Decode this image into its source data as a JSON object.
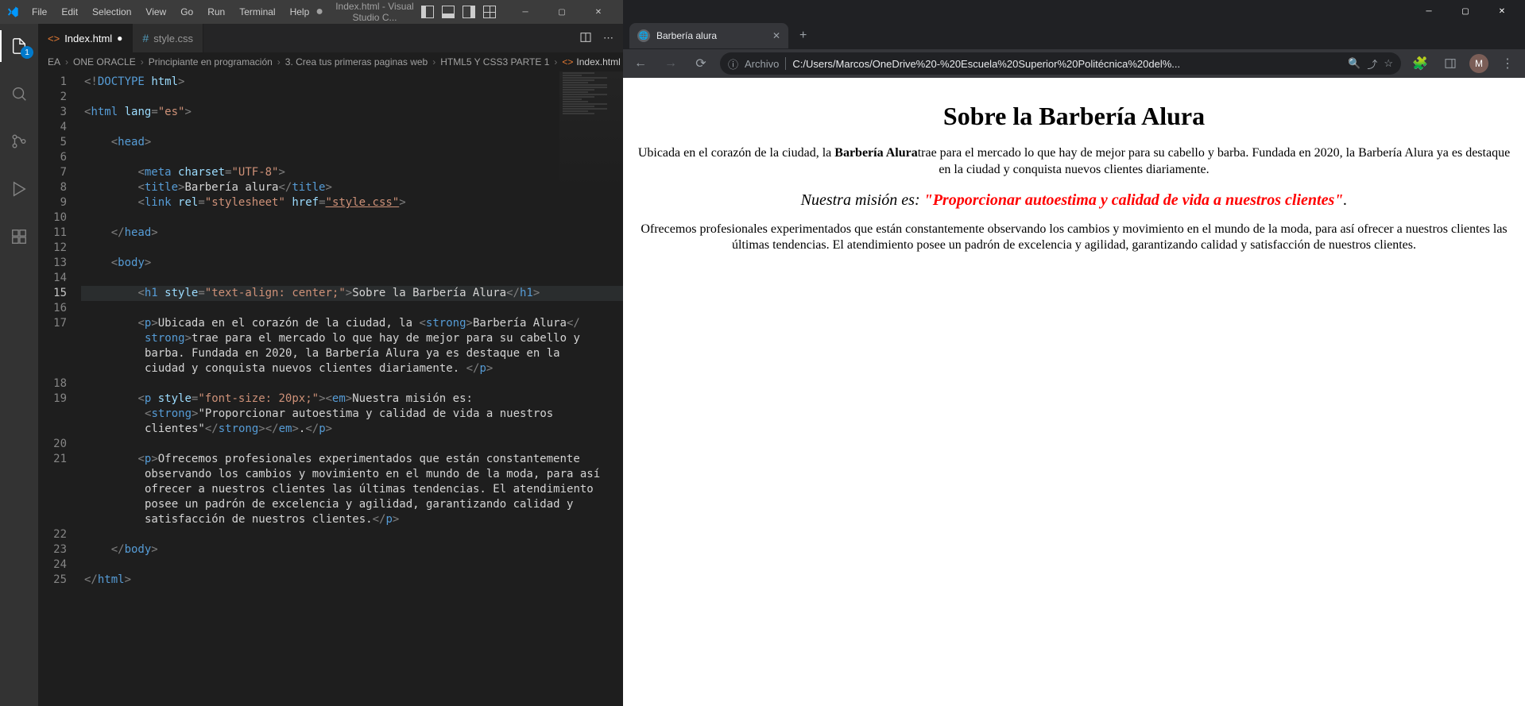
{
  "vscode": {
    "menu": [
      "File",
      "Edit",
      "Selection",
      "View",
      "Go",
      "Run",
      "Terminal",
      "Help"
    ],
    "window_title": "Index.html - Visual Studio C...",
    "activity_badge": "1",
    "tabs": [
      {
        "label": "Index.html",
        "modified": true,
        "icon": "html"
      },
      {
        "label": "style.css",
        "modified": false,
        "icon": "css"
      }
    ],
    "breadcrumbs": [
      "EA",
      "ONE ORACLE",
      "Principiante en programación",
      "3. Crea tus primeras paginas web",
      "HTML5 Y CSS3 PARTE 1",
      "Index.html"
    ],
    "code": {
      "lines": [
        {
          "n": 1,
          "html": "<span class='c-punct'>&lt;!</span><span class='c-doctype'>DOCTYPE</span> <span class='c-attr'>html</span><span class='c-punct'>&gt;</span>"
        },
        {
          "n": 2,
          "html": ""
        },
        {
          "n": 3,
          "html": "<span class='c-punct'>&lt;</span><span class='c-tag'>html</span> <span class='c-attr'>lang</span><span class='c-punct'>=</span><span class='c-str'>\"es\"</span><span class='c-punct'>&gt;</span>"
        },
        {
          "n": 4,
          "html": ""
        },
        {
          "n": 5,
          "html": "    <span class='c-punct'>&lt;</span><span class='c-tag'>head</span><span class='c-punct'>&gt;</span>"
        },
        {
          "n": 6,
          "html": ""
        },
        {
          "n": 7,
          "html": "        <span class='c-punct'>&lt;</span><span class='c-tag'>meta</span> <span class='c-attr'>charset</span><span class='c-punct'>=</span><span class='c-str'>\"UTF-8\"</span><span class='c-punct'>&gt;</span>"
        },
        {
          "n": 8,
          "html": "        <span class='c-punct'>&lt;</span><span class='c-tag'>title</span><span class='c-punct'>&gt;</span><span class='c-text'>Barbería alura</span><span class='c-punct'>&lt;/</span><span class='c-tag'>title</span><span class='c-punct'>&gt;</span>"
        },
        {
          "n": 9,
          "html": "        <span class='c-punct'>&lt;</span><span class='c-tag'>link</span> <span class='c-attr'>rel</span><span class='c-punct'>=</span><span class='c-str'>\"stylesheet\"</span> <span class='c-attr'>href</span><span class='c-punct'>=</span><span class='c-href'>\"style.css\"</span><span class='c-punct'>&gt;</span>"
        },
        {
          "n": 10,
          "html": ""
        },
        {
          "n": 11,
          "html": "    <span class='c-punct'>&lt;/</span><span class='c-tag'>head</span><span class='c-punct'>&gt;</span>"
        },
        {
          "n": 12,
          "html": ""
        },
        {
          "n": 13,
          "html": "    <span class='c-punct'>&lt;</span><span class='c-tag'>body</span><span class='c-punct'>&gt;</span>"
        },
        {
          "n": 14,
          "html": ""
        },
        {
          "n": 15,
          "active": true,
          "html": "        <span class='c-punct'>&lt;</span><span class='c-tag'>h1</span> <span class='c-attr'>style</span><span class='c-punct'>=</span><span class='c-str'>\"text-align: center;\"</span><span class='c-punct'>&gt;</span><span class='c-text'>Sobre la Barbería Alura</span><span class='c-punct'>&lt;/</span><span class='c-tag'>h1</span><span class='c-punct'>&gt;</span>"
        },
        {
          "n": 16,
          "html": ""
        },
        {
          "n": 17,
          "html": "        <span class='c-punct'>&lt;</span><span class='c-tag'>p</span><span class='c-punct'>&gt;</span><span class='c-text'>Ubicada en el corazón de la ciudad, la </span><span class='c-punct'>&lt;</span><span class='c-tag'>strong</span><span class='c-punct'>&gt;</span><span class='c-text'>Barbería Alura</span><span class='c-punct'>&lt;/</span>"
        },
        {
          "n": null,
          "wrap": true,
          "html": "<span class='c-tag'>strong</span><span class='c-punct'>&gt;</span><span class='c-text'>trae para el mercado lo que hay de mejor para su cabello y </span>"
        },
        {
          "n": null,
          "wrap": true,
          "html": "<span class='c-text'>barba. Fundada en 2020, la Barbería Alura ya es destaque en la </span>"
        },
        {
          "n": null,
          "wrap": true,
          "html": "<span class='c-text'>ciudad y conquista nuevos clientes diariamente. </span><span class='c-punct'>&lt;/</span><span class='c-tag'>p</span><span class='c-punct'>&gt;</span>"
        },
        {
          "n": 18,
          "html": ""
        },
        {
          "n": 19,
          "html": "        <span class='c-punct'>&lt;</span><span class='c-tag'>p</span> <span class='c-attr'>style</span><span class='c-punct'>=</span><span class='c-str'>\"font-size: 20px;\"</span><span class='c-punct'>&gt;&lt;</span><span class='c-tag'>em</span><span class='c-punct'>&gt;</span><span class='c-text'>Nuestra misión es: </span>"
        },
        {
          "n": null,
          "wrap": true,
          "html": "<span class='c-punct'>&lt;</span><span class='c-tag'>strong</span><span class='c-punct'>&gt;</span><span class='c-text'>\"Proporcionar autoestima y calidad de vida a nuestros </span>"
        },
        {
          "n": null,
          "wrap": true,
          "html": "<span class='c-text'>clientes\"</span><span class='c-punct'>&lt;/</span><span class='c-tag'>strong</span><span class='c-punct'>&gt;&lt;/</span><span class='c-tag'>em</span><span class='c-punct'>&gt;</span><span class='c-text'>.</span><span class='c-punct'>&lt;/</span><span class='c-tag'>p</span><span class='c-punct'>&gt;</span>"
        },
        {
          "n": 20,
          "html": ""
        },
        {
          "n": 21,
          "html": "        <span class='c-punct'>&lt;</span><span class='c-tag'>p</span><span class='c-punct'>&gt;</span><span class='c-text'>Ofrecemos profesionales experimentados que están constantemente </span>"
        },
        {
          "n": null,
          "wrap": true,
          "html": "<span class='c-text'>observando los cambios y movimiento en el mundo de la moda, para así </span>"
        },
        {
          "n": null,
          "wrap": true,
          "html": "<span class='c-text'>ofrecer a nuestros clientes las últimas tendencias. El atendimiento </span>"
        },
        {
          "n": null,
          "wrap": true,
          "html": "<span class='c-text'>posee un padrón de excelencia y agilidad, garantizando calidad y </span>"
        },
        {
          "n": null,
          "wrap": true,
          "html": "<span class='c-text'>satisfacción de nuestros clientes.</span><span class='c-punct'>&lt;/</span><span class='c-tag'>p</span><span class='c-punct'>&gt;</span>"
        },
        {
          "n": 22,
          "html": ""
        },
        {
          "n": 23,
          "html": "    <span class='c-punct'>&lt;/</span><span class='c-tag'>body</span><span class='c-punct'>&gt;</span>"
        },
        {
          "n": 24,
          "html": ""
        },
        {
          "n": 25,
          "html": "<span class='c-punct'>&lt;/</span><span class='c-tag'>html</span><span class='c-punct'>&gt;</span>"
        }
      ]
    }
  },
  "browser": {
    "tab_title": "Barbería alura",
    "address_label": "Archivo",
    "url": "C:/Users/Marcos/OneDrive%20-%20Escuela%20Superior%20Politécnica%20del%...",
    "avatar_initial": "M",
    "page": {
      "h1": "Sobre la Barbería Alura",
      "p1_before": "Ubicada en el corazón de la ciudad, la ",
      "p1_strong": "Barbería Alura",
      "p1_after": "trae para el mercado lo que hay de mejor para su cabello y barba. Fundada en 2020, la Barbería Alura ya es destaque en la ciudad y conquista nuevos clientes diariamente.",
      "mission_label": "Nuestra misión es: ",
      "mission_quote": "\"Proporcionar autoestima y calidad de vida a nuestros clientes\"",
      "mission_period": ".",
      "p3": "Ofrecemos profesionales experimentados que están constantemente observando los cambios y movimiento en el mundo de la moda, para así ofrecer a nuestros clientes las últimas tendencias. El atendimiento posee un padrón de excelencia y agilidad, garantizando calidad y satisfacción de nuestros clientes."
    }
  }
}
